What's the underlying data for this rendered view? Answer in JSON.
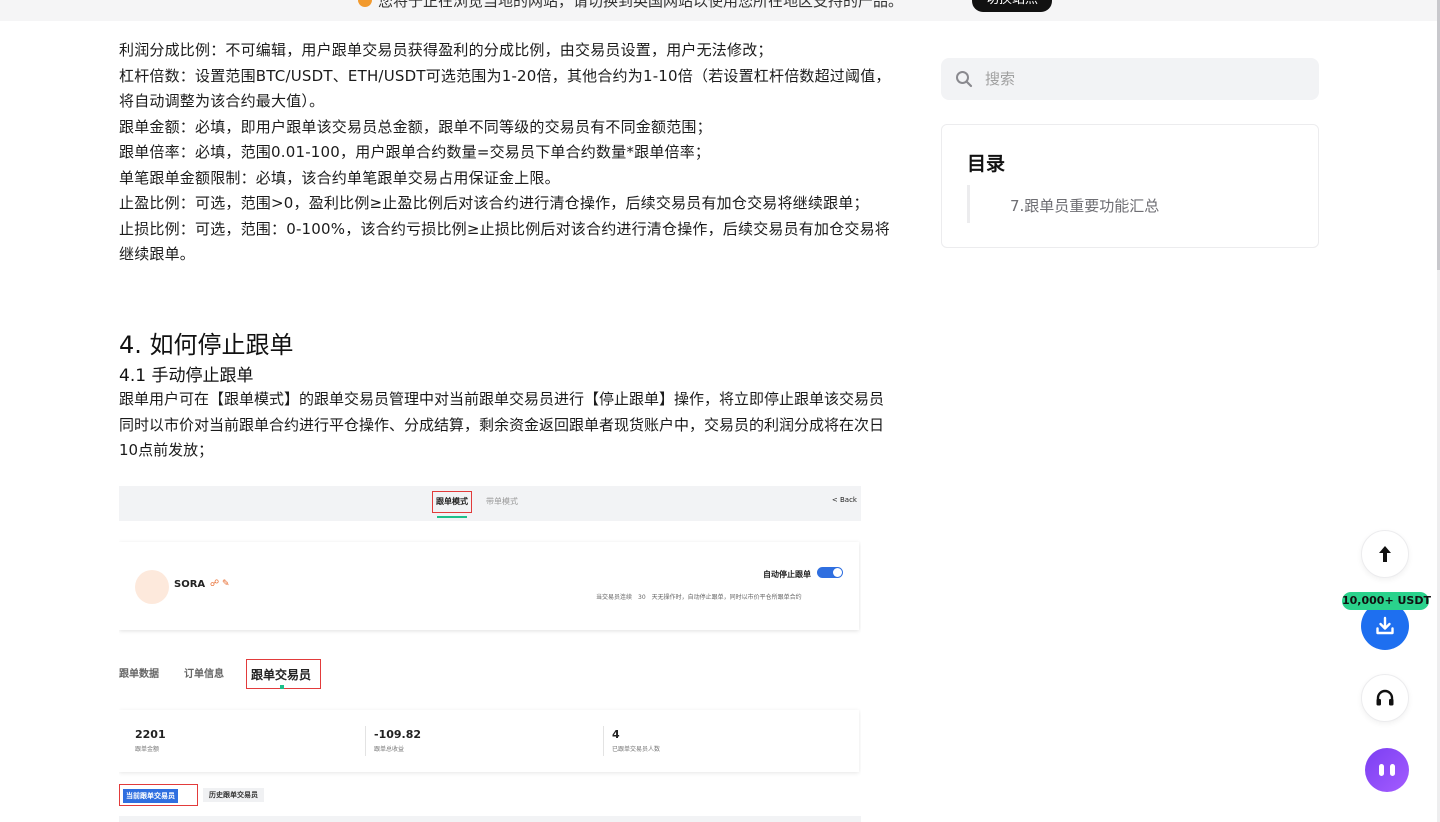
{
  "banner": {
    "notice": "您将于正在浏览当地的网站，请切换到英国网站以使用您所在地区支持的产品。",
    "switch_label": "切换站点"
  },
  "article": {
    "paragraphs": [
      "利润分成比例：不可编辑，用户跟单交易员获得盈利的分成比例，由交易员设置，用户无法修改；",
      "杠杆倍数：设置范围BTC/USDT、ETH/USDT可选范围为1-20倍，其他合约为1-10倍（若设置杠杆倍数超过阈值，将自动调整为该合约最大值）。",
      "跟单金额：必填，即用户跟单该交易员总金额，跟单不同等级的交易员有不同金额范围；",
      "跟单倍率：必填，范围0.01-100，用户跟单合约数量=交易员下单合约数量*跟单倍率；",
      "单笔跟单金额限制：必填，该合约单笔跟单交易占用保证金上限。",
      "止盈比例：可选，范围>0，盈利比例≥止盈比例后对该合约进行清仓操作，后续交易员有加仓交易将继续跟单；",
      "止损比例：可选，范围：0-100%，该合约亏损比例≥止损比例后对该合约进行清仓操作，后续交易员有加仓交易将继续跟单。"
    ],
    "section_title": "4. 如何停止跟单",
    "subsection_title": "4.1 手动停止跟单",
    "section_paragraph": "跟单用户可在【跟单模式】的跟单交易员管理中对当前跟单交易员进行【停止跟单】操作，将立即停止跟单该交易员同时以市价对当前跟单合约进行平仓操作、分成结算，剩余资金返回跟单者现货账户中，交易员的利润分成将在次日10点前发放；"
  },
  "screenshot": {
    "tab_follow_mode": "跟单模式",
    "tab_lead_mode": "带单模式",
    "back": "< Back",
    "trader_name": "SORA",
    "auto_stop_label": "自动停止跟单",
    "auto_stop_desc": "当交易员连续　30　天无操作时，自动停止跟单，同时以市价平仓所跟单合约",
    "tab_data": "跟单数据",
    "tab_orders": "订单信息",
    "tab_traders": "跟单交易员",
    "stat1_value": "2201",
    "stat1_label": "跟单金额",
    "stat2_value": "-109.82",
    "stat2_label": "跟单总收益",
    "stat3_value": "4",
    "stat3_label": "已跟单交易员人数",
    "subtab_current": "当前跟单交易员",
    "subtab_history": "历史跟单交易员"
  },
  "sidebar": {
    "search_placeholder": "搜索",
    "toc_title": "目录",
    "toc_items": [
      "7.跟单员重要功能汇总"
    ]
  },
  "floating": {
    "reward_badge": "10,000+ USDT"
  },
  "colors": {
    "accent_blue": "#1e6ff0",
    "reward_green": "#2ad28c",
    "highlight_red": "#e23b3b",
    "bot_purple": "#8a48f5"
  }
}
